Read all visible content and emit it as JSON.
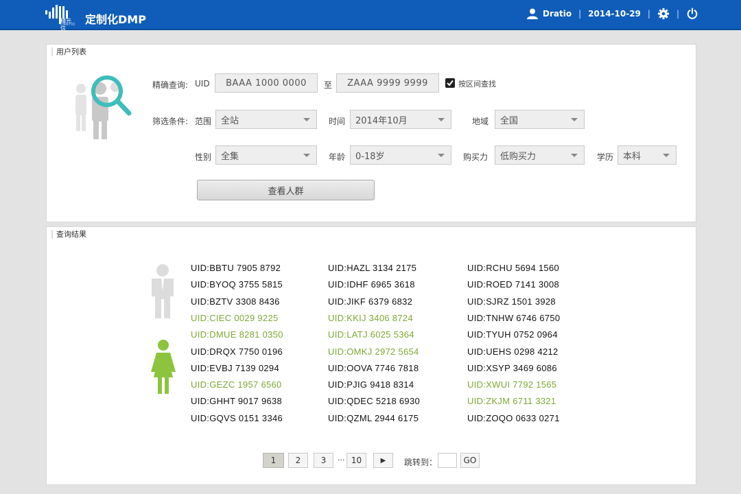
{
  "header": {
    "logo_cn": "精元信",
    "logo_en": "DRATIO",
    "title": "定制化DMP",
    "user": "Dratio",
    "date": "2014-10-29",
    "sep": "|",
    "icons": [
      "user-icon",
      "gear-icon",
      "power-icon"
    ]
  },
  "search_panel": {
    "title": "用户列表",
    "exact_label": "精确查询:",
    "uid_label": "UID",
    "uid_from": "BAAA 1000 0000",
    "to_label": "至",
    "uid_to": "ZAAA 9999 9999",
    "range_checkbox_label": "按区间查找",
    "range_checkbox_checked": true,
    "filter_label": "筛选条件:",
    "filters": {
      "scope": {
        "label": "范围",
        "value": "全站"
      },
      "time": {
        "label": "时间",
        "value": "2014年10月"
      },
      "region": {
        "label": "地域",
        "value": "全国"
      },
      "gender": {
        "label": "性别",
        "value": "全集"
      },
      "age": {
        "label": "年龄",
        "value": "0-18岁"
      },
      "purchase": {
        "label": "购买力",
        "value": "低购买力"
      },
      "education": {
        "label": "学历",
        "value": "本科"
      }
    },
    "submit_label": "查看人群"
  },
  "results_panel": {
    "title": "查询结果",
    "columns": [
      [
        {
          "text": "UID:BBTU 7905 8792",
          "female": false
        },
        {
          "text": "UID:BYOQ 3755 5815",
          "female": false
        },
        {
          "text": "UID:BZTV 3308 8436",
          "female": false
        },
        {
          "text": "UID:CIEC 0029 9225",
          "female": true
        },
        {
          "text": "UID:DMUE 8281 0350",
          "female": true
        },
        {
          "text": "UID:DRQX 7750 0196",
          "female": false
        },
        {
          "text": "UID:EVBJ 7139 0294",
          "female": false
        },
        {
          "text": "UID:GEZC 1957 6560",
          "female": true
        },
        {
          "text": "UID:GHHT 9017 9638",
          "female": false
        },
        {
          "text": "UID:GQVS 0151 3346",
          "female": false
        }
      ],
      [
        {
          "text": "UID:HAZL 3134 2175",
          "female": false
        },
        {
          "text": "UID:IDHF 6965 3618",
          "female": false
        },
        {
          "text": "UID:JIKF 6379 6832",
          "female": false
        },
        {
          "text": "UID:KKIJ 3406 8724",
          "female": true
        },
        {
          "text": "UID:LATJ 6025 5364",
          "female": true
        },
        {
          "text": "UID:OMKJ 2972 5654",
          "female": true
        },
        {
          "text": "UID:OOVA 7746 7818",
          "female": false
        },
        {
          "text": "UID:PJIG 9418 8314",
          "female": false
        },
        {
          "text": "UID:QDEC 5218 6930",
          "female": false
        },
        {
          "text": "UID:QZML 2944 6175",
          "female": false
        }
      ],
      [
        {
          "text": "UID:RCHU 5694 1560",
          "female": false
        },
        {
          "text": "UID:ROED 7141 3008",
          "female": false
        },
        {
          "text": "UID:SJRZ 1501 3928",
          "female": false
        },
        {
          "text": "UID:TNHW 6746 6750",
          "female": false
        },
        {
          "text": "UID:TYUH 0752 0964",
          "female": false
        },
        {
          "text": "UID:UEHS 0298 4212",
          "female": false
        },
        {
          "text": "UID:XSYP 3469 6086",
          "female": false
        },
        {
          "text": "UID:XWUI 7792 1565",
          "female": true
        },
        {
          "text": "UID:ZKJM 6711 3321",
          "female": true
        },
        {
          "text": "UID:ZOQO 0633 0271",
          "female": false
        }
      ]
    ],
    "colors": {
      "male": "#111111",
      "female": "#7ca832"
    },
    "pagination": {
      "pages": [
        "1",
        "2",
        "3",
        "10"
      ],
      "current": "1",
      "ellipsis": "···",
      "next": "▶",
      "jump_label": "跳转到：",
      "go_label": "GO"
    }
  }
}
